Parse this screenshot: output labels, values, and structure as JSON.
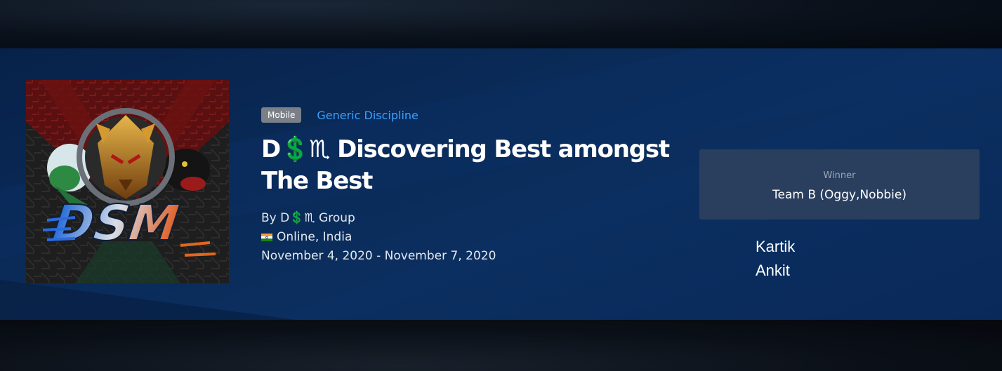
{
  "tournament": {
    "platform_badge": "Mobile",
    "discipline": "Generic Discipline",
    "title_line1": "D💲♏ Discovering Best amongst",
    "title_line2": "The Best",
    "organizer": "By D💲♏ Group",
    "location": "Online, India",
    "location_flag": "india-flag-icon",
    "dates": "November 4, 2020 - November 7, 2020"
  },
  "logo": {
    "text": "DSM",
    "icon": "dsm-team-logo"
  },
  "winner": {
    "label": "Winner",
    "team": "Team B (Oggy,Nobbie)",
    "members": [
      "Kartik",
      "Ankit"
    ]
  },
  "colors": {
    "banner": "#0a2a57",
    "discipline_link": "#3aa0ff",
    "badge": "#7b8088",
    "winner_box": "#2a3f5e"
  }
}
